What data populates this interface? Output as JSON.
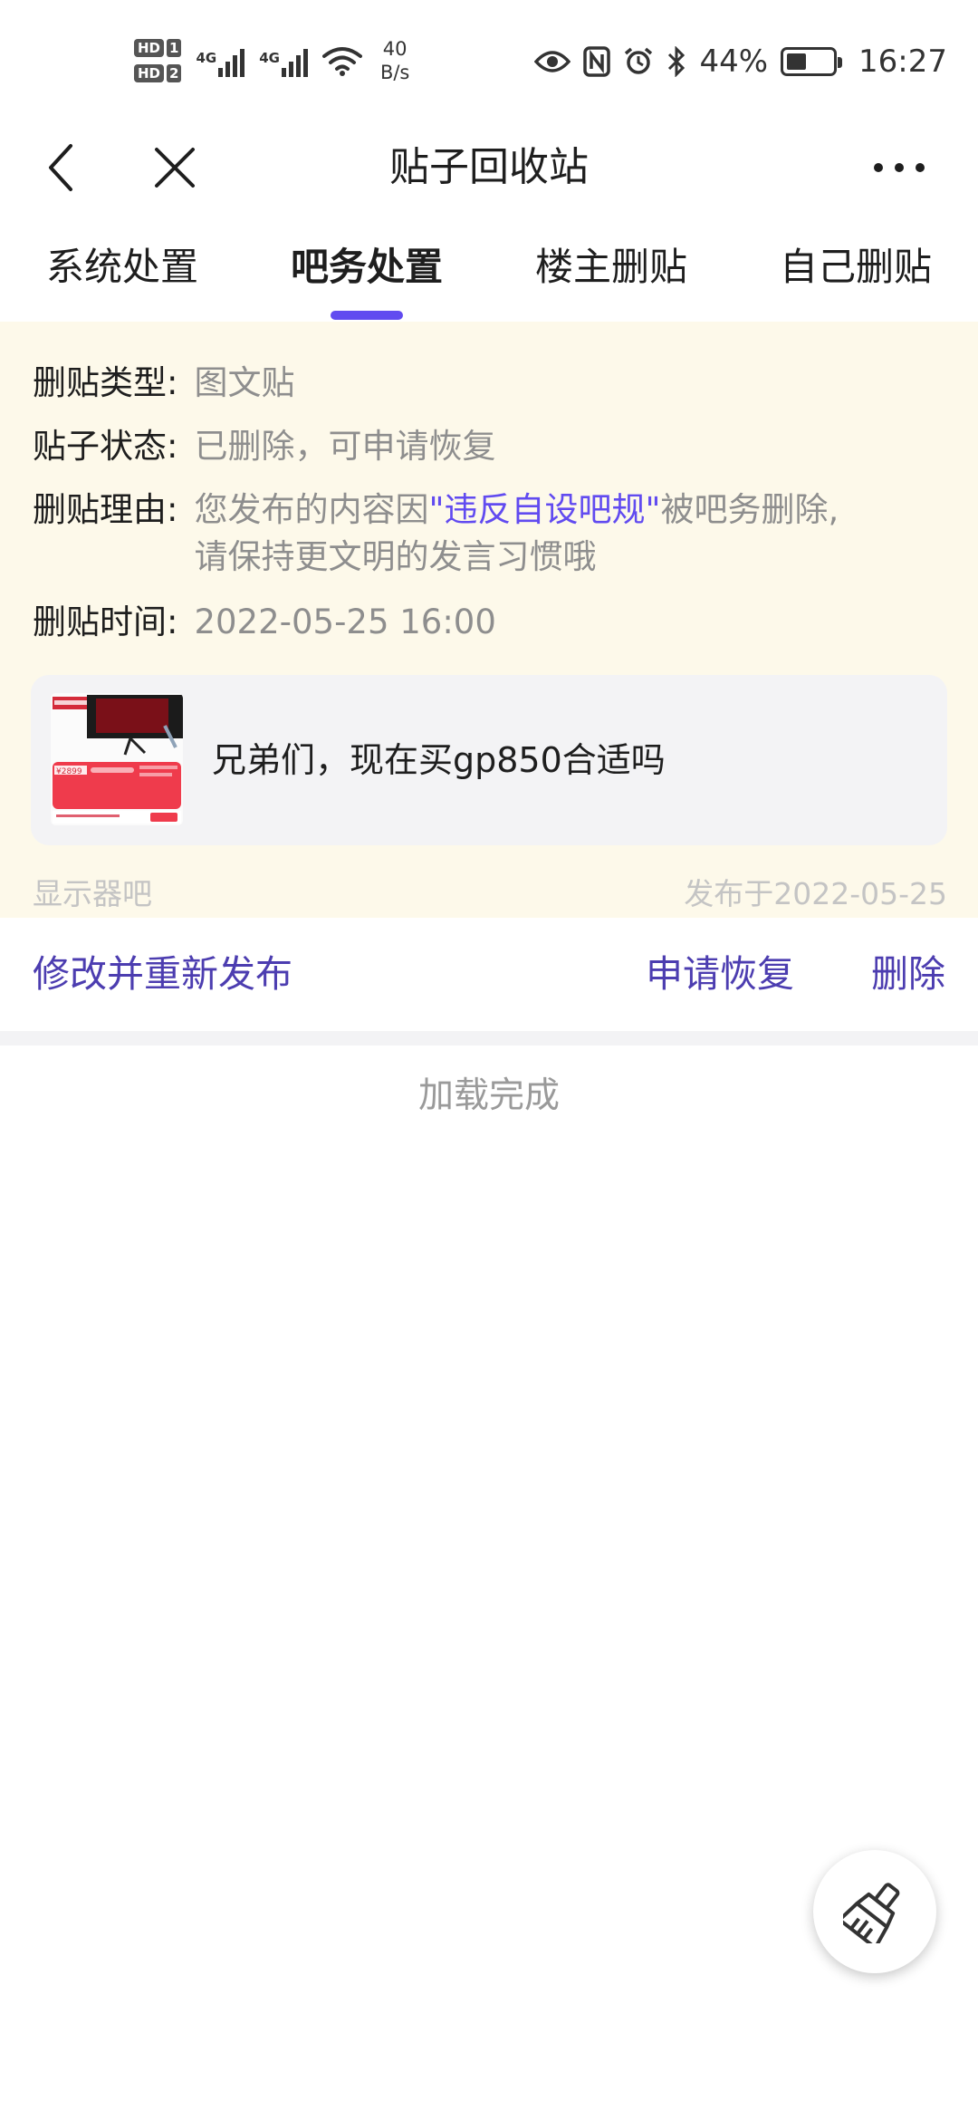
{
  "status_bar": {
    "sim1": "HD",
    "sim1_num": "1",
    "sim2": "HD",
    "sim2_num": "2",
    "net1": "4G",
    "net2": "4G",
    "speed_value": "40",
    "speed_unit": "B/s",
    "battery_text": "44%",
    "battery_level": 0.44,
    "time": "16:27",
    "icons": [
      "eye-icon",
      "nfc-icon",
      "alarm-icon",
      "bluetooth-icon",
      "battery-icon",
      "wifi-icon",
      "signal-icon"
    ]
  },
  "nav": {
    "title": "贴子回收站",
    "back_icon": "chevron-left-icon",
    "close_icon": "close-icon",
    "more_icon": "more-icon"
  },
  "tabs": [
    {
      "label": "系统处置",
      "active": false
    },
    {
      "label": "吧务处置",
      "active": true
    },
    {
      "label": "楼主删贴",
      "active": false
    },
    {
      "label": "自己删贴",
      "active": false
    }
  ],
  "card": {
    "type_label": "删贴类型:",
    "type_value": "图文贴",
    "status_label": "贴子状态:",
    "status_value": "已删除，可申请恢复",
    "reason_label": "删贴理由:",
    "reason_prefix": "您发布的内容因",
    "reason_highlight": "\"违反自设吧规\"",
    "reason_suffix": "被吧务删除,",
    "reason_line2": "请保持更文明的发言习惯哦",
    "time_label": "删贴时间:",
    "time_value": "2022-05-25 16:00",
    "post": {
      "title": "兄弟们，现在买gp850合适吗",
      "thumb_price": "¥2899"
    },
    "forum": "显示器吧",
    "published": "发布于2022-05-25"
  },
  "actions": {
    "edit_republish": "修改并重新发布",
    "apply_restore": "申请恢复",
    "delete": "删除"
  },
  "footer": {
    "loading_done": "加载完成"
  },
  "fab": {
    "icon": "broom-icon"
  },
  "colors": {
    "accent": "#614BF0",
    "action_text": "#4C3DB0",
    "card_bg": "#FDF9EA",
    "post_bg": "#F3F3F5"
  }
}
